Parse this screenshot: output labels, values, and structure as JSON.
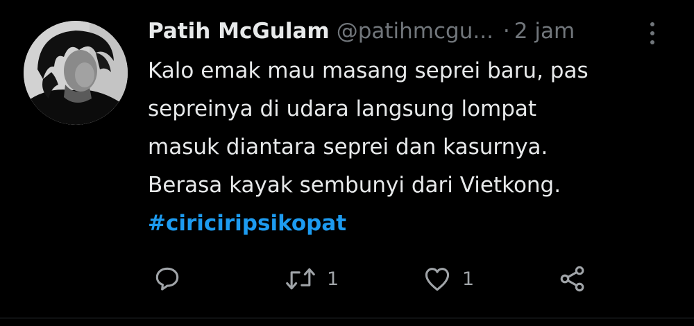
{
  "tweet": {
    "author_name": "Patih McGulam",
    "handle": "@patihmcgu...",
    "separator": "·",
    "time": "2 jam",
    "lines": [
      "Kalo emak mau masang seprei baru, pas",
      "sepreinya di udara langsung lompat",
      "masuk diantara seprei dan kasurnya.",
      "Berasa kayak sembunyi dari Vietkong."
    ],
    "hashtag": "#ciriciripsikopat",
    "retweet_count": "1",
    "like_count": "1"
  },
  "icons": {
    "reply": "reply-icon",
    "retweet": "retweet-icon",
    "like": "heart-icon",
    "share": "share-icon",
    "more": "more-options-icon"
  },
  "colors": {
    "background": "#000000",
    "text": "#e7e9ea",
    "muted": "#71767b",
    "link": "#1d9bf0"
  }
}
